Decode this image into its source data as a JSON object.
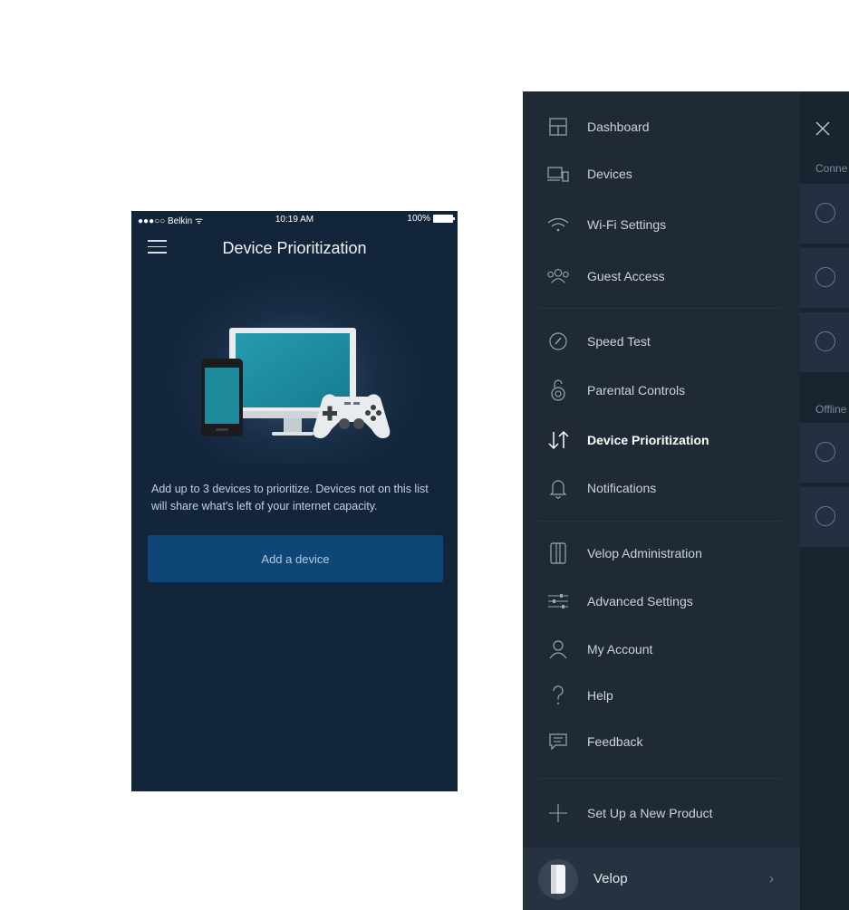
{
  "phone": {
    "status": {
      "carrier": "●●●○○ Belkin ᯤ",
      "time": "10:19 AM",
      "battery": "100%"
    },
    "title": "Device Prioritization",
    "description": "Add up to 3 devices to prioritize. Devices not on this list will share what's left of your internet capacity.",
    "add_button": "Add a device"
  },
  "menu": {
    "items": [
      {
        "label": "Dashboard",
        "icon": "dashboard-icon"
      },
      {
        "label": "Devices",
        "icon": "devices-icon"
      },
      {
        "label": "Wi-Fi Settings",
        "icon": "wifi-icon"
      },
      {
        "label": "Guest Access",
        "icon": "guest-access-icon"
      },
      {
        "label": "Speed Test",
        "icon": "speed-test-icon"
      },
      {
        "label": "Parental Controls",
        "icon": "parental-controls-icon"
      },
      {
        "label": "Device Prioritization",
        "icon": "device-prioritization-icon",
        "active": true
      },
      {
        "label": "Notifications",
        "icon": "bell-icon"
      },
      {
        "label": "Velop Administration",
        "icon": "velop-node-icon"
      },
      {
        "label": "Advanced Settings",
        "icon": "sliders-icon"
      },
      {
        "label": "My Account",
        "icon": "user-icon"
      },
      {
        "label": "Help",
        "icon": "question-icon"
      },
      {
        "label": "Feedback",
        "icon": "feedback-icon"
      },
      {
        "label": "Set Up a New Product",
        "icon": "plus-icon"
      }
    ],
    "footer": {
      "label": "Velop",
      "chevron": "›"
    }
  },
  "behind_panel": {
    "connected_label": "Conne",
    "offline_label": "Offline"
  }
}
